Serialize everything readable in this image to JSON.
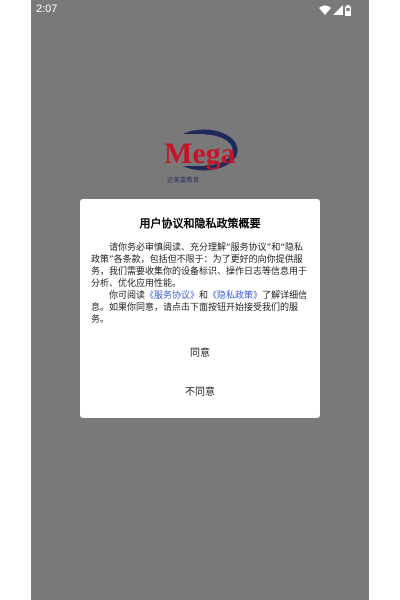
{
  "status_bar": {
    "time": "2:07",
    "icons": [
      "wifi-icon",
      "signal-icon",
      "battery-icon"
    ]
  },
  "logo": {
    "text": "Mega",
    "subtitle": "迈美嘉教育",
    "colors": {
      "accent": "#c4162a",
      "primary": "#1f2a5c"
    }
  },
  "dialog": {
    "title": "用户协议和隐私政策概要",
    "para1": "请你务必审慎阅读、充分理解“服务协议”和“隐私政策”各条款，包括但不限于：为了更好的向你提供服务，我们需要收集你的设备标识、操作日志等信息用于分析、优化应用性能。",
    "para2_prefix": "你可阅读",
    "service_link": "《服务协议》",
    "and": "和",
    "privacy_link": "《隐私政策》",
    "para2_suffix": "了解详细信息。如果你同意，请点击下面按钮开始接受我们的服务。",
    "agree_label": "同意",
    "disagree_label": "不同意",
    "link_color": "#3a5bd9"
  },
  "colors": {
    "overlay": "#797979",
    "dialog_bg": "#ffffff"
  }
}
